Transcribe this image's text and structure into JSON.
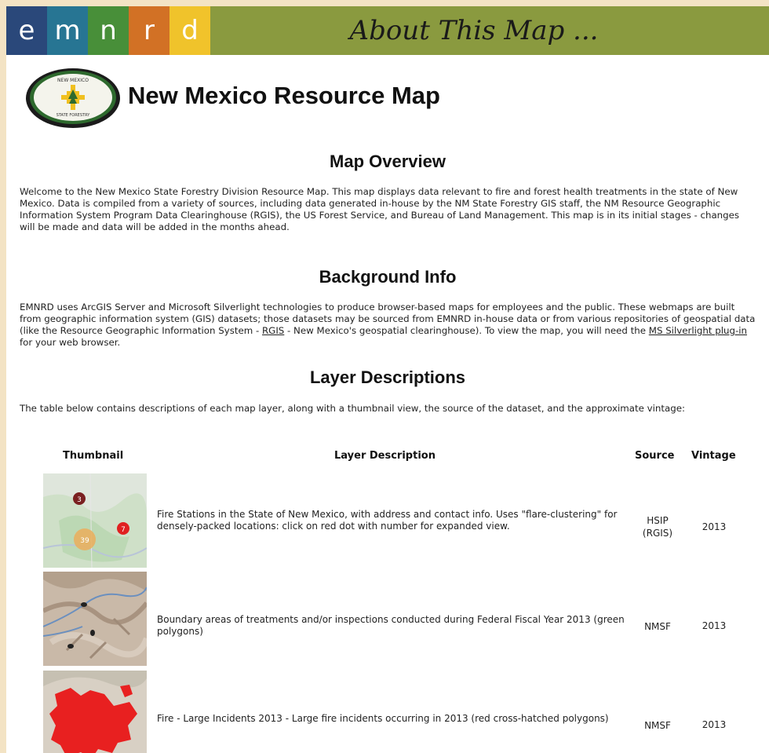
{
  "banner": {
    "letters": [
      "e",
      "m",
      "n",
      "r",
      "d"
    ],
    "tile_colors": [
      "#1f3f73",
      "#1c6e8e",
      "#3f8a2f",
      "#d06a1a",
      "#f0c020"
    ],
    "title": "About This Map ..."
  },
  "header": {
    "logo_icon": "nm-state-forestry-seal",
    "logo_text_top": "NEW MEXICO",
    "logo_text_bottom": "STATE FORESTRY",
    "title": "New Mexico Resource Map"
  },
  "overview": {
    "heading": "Map Overview",
    "body": "Welcome to the New Mexico State Forestry Division Resource Map. This map displays data relevant to fire and forest health treatments in the state of New Mexico. Data is compiled from a variety of sources, including data generated in-house by the NM State Forestry GIS staff, the NM Resource Geographic Information System Program Data Clearinghouse (RGIS), the US Forest Service, and Bureau of Land Management. This map is in its initial stages - changes will be made and data will be added in the months ahead."
  },
  "background": {
    "heading": "Background Info",
    "body_1": "EMNRD uses ArcGIS Server and Microsoft Silverlight technologies to produce browser-based maps for employees and the public. These webmaps are built from geographic information system (GIS) datasets; those datasets may be sourced from EMNRD in-house data or from various repositories of geospatial data (like the Resource Geographic Information System - ",
    "link_rgis": "RGIS",
    "body_2": " - New Mexico's geospatial clearinghouse). To view the map, you will need the ",
    "link_silverlight": "MS Silverlight plug-in",
    "body_3": " for your web browser."
  },
  "layers": {
    "heading": "Layer Descriptions",
    "intro": "The table below contains descriptions of each map layer, along with a thumbnail view, the source of the dataset, and the approximate vintage:",
    "columns": {
      "thumbnail": "Thumbnail",
      "description": "Layer Description",
      "source": "Source",
      "vintage": "Vintage"
    },
    "rows": [
      {
        "description": "Fire Stations in the State of New Mexico, with address and contact info. Uses \"flare-clustering\" for densely-packed locations: click on red dot with number for expanded view.",
        "source_line1": "HSIP",
        "source_line2": "(RGIS)",
        "vintage": "2013",
        "thumb_labels": [
          "3",
          "7",
          "39"
        ]
      },
      {
        "description": "Boundary areas of treatments and/or inspections conducted during Federal Fiscal Year 2013 (green polygons)",
        "source_line1": "NMSF",
        "source_line2": "",
        "vintage": "2013"
      },
      {
        "description": "Fire - Large Incidents 2013 - Large fire incidents occurring in 2013 (red cross-hatched polygons)",
        "source_line1": "NMSF",
        "source_line2": "",
        "vintage": "2013"
      }
    ]
  }
}
